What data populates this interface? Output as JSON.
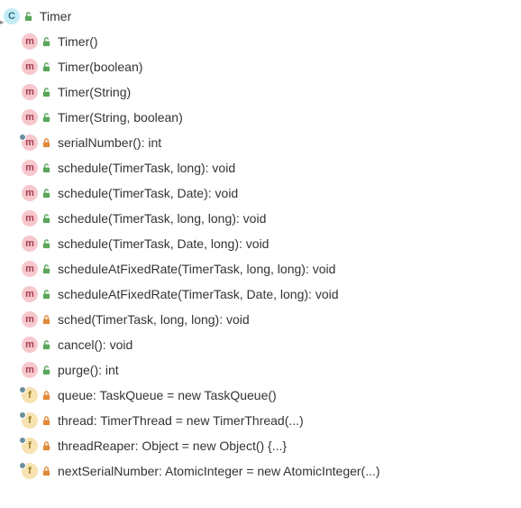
{
  "class": {
    "name": "Timer"
  },
  "members": [
    {
      "kind": "method",
      "access": "public",
      "label": "Timer()"
    },
    {
      "kind": "method",
      "access": "public",
      "label": "Timer(boolean)"
    },
    {
      "kind": "method",
      "access": "public",
      "label": "Timer(String)"
    },
    {
      "kind": "method",
      "access": "public",
      "label": "Timer(String, boolean)"
    },
    {
      "kind": "method",
      "access": "private",
      "label": "serialNumber(): int",
      "static": true
    },
    {
      "kind": "method",
      "access": "public",
      "label": "schedule(TimerTask, long): void"
    },
    {
      "kind": "method",
      "access": "public",
      "label": "schedule(TimerTask, Date): void"
    },
    {
      "kind": "method",
      "access": "public",
      "label": "schedule(TimerTask, long, long): void"
    },
    {
      "kind": "method",
      "access": "public",
      "label": "schedule(TimerTask, Date, long): void"
    },
    {
      "kind": "method",
      "access": "public",
      "label": "scheduleAtFixedRate(TimerTask, long, long): void"
    },
    {
      "kind": "method",
      "access": "public",
      "label": "scheduleAtFixedRate(TimerTask, Date, long): void"
    },
    {
      "kind": "method",
      "access": "private",
      "label": "sched(TimerTask, long, long): void"
    },
    {
      "kind": "method",
      "access": "public",
      "label": "cancel(): void"
    },
    {
      "kind": "method",
      "access": "public",
      "label": "purge(): int"
    },
    {
      "kind": "field",
      "access": "private",
      "label": "queue: TaskQueue = new TaskQueue()",
      "static": true
    },
    {
      "kind": "field",
      "access": "private",
      "label": "thread: TimerThread = new TimerThread(...)",
      "static": true
    },
    {
      "kind": "field",
      "access": "private",
      "label": "threadReaper: Object = new Object() {...}",
      "static": true
    },
    {
      "kind": "field",
      "access": "private",
      "label": "nextSerialNumber: AtomicInteger = new AtomicInteger(...)",
      "static": true
    }
  ],
  "glyphs": {
    "class": "C",
    "method": "m",
    "field": "f"
  }
}
